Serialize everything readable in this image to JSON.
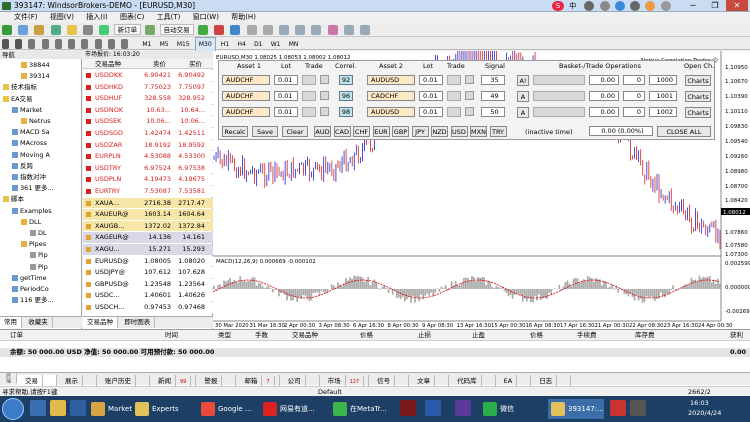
{
  "window": {
    "title": "393147: WindsorBrokers-DEMO - [EURUSD,M30]",
    "controls": [
      "─",
      "❐",
      "✕"
    ]
  },
  "ime": {
    "label": "中"
  },
  "menu": [
    "文件(F)",
    "视图(V)",
    "插入(I)",
    "图表(C)",
    "工具(T)",
    "窗口(W)",
    "帮助(H)"
  ],
  "toolbar": {
    "new_order": "新订单",
    "auto_trade": "自动交易"
  },
  "timeframes": [
    "M1",
    "M5",
    "M15",
    "M30",
    "H1",
    "H4",
    "D1",
    "W1",
    "MN"
  ],
  "navigator": {
    "title": "导航",
    "items": [
      {
        "label": "38844",
        "level": 2
      },
      {
        "label": "39314",
        "level": 2
      },
      {
        "label": "技术指标",
        "level": 0
      },
      {
        "label": "EA交易",
        "level": 0
      },
      {
        "label": "Market",
        "level": 1
      },
      {
        "label": "Netrus",
        "level": 2
      },
      {
        "label": "MACD Sa",
        "level": 1
      },
      {
        "label": "MAcross",
        "level": 1
      },
      {
        "label": "Moving A",
        "level": 1
      },
      {
        "label": "反跨",
        "level": 1
      },
      {
        "label": "指数对冲",
        "level": 1
      },
      {
        "label": "361 更多...",
        "level": 1
      },
      {
        "label": "脚本",
        "level": 0
      },
      {
        "label": "Examples",
        "level": 1
      },
      {
        "label": "DLL",
        "level": 2
      },
      {
        "label": "DL",
        "level": 3
      },
      {
        "label": "Pipes",
        "level": 2
      },
      {
        "label": "Pip",
        "level": 3
      },
      {
        "label": "Pip",
        "level": 3
      },
      {
        "label": "getTime",
        "level": 1
      },
      {
        "label": "PeriodCo",
        "level": 1
      },
      {
        "label": "116 更多...",
        "level": 1
      }
    ],
    "tabs": [
      "常用",
      "收藏夹"
    ]
  },
  "market_watch": {
    "title": "市场报价: 16:03:20",
    "headers": {
      "symbol": "交易品种",
      "bid": "卖价",
      "ask": "买价"
    },
    "rows": [
      {
        "symbol": "USDDKK",
        "bid": "6.90421",
        "ask": "6.90492",
        "style": "red"
      },
      {
        "symbol": "USDHKD",
        "bid": "7.75023",
        "ask": "7.75097",
        "style": "red"
      },
      {
        "symbol": "USDHUF",
        "bid": "328.558",
        "ask": "328.952",
        "style": "red"
      },
      {
        "symbol": "USDNOK",
        "bid": "10.63...",
        "ask": "10.64...",
        "style": "red"
      },
      {
        "symbol": "USDSEK",
        "bid": "10.06...",
        "ask": "10.06...",
        "style": "red"
      },
      {
        "symbol": "USDSGD",
        "bid": "1.42474",
        "ask": "1.42511",
        "style": "red"
      },
      {
        "symbol": "USDZAR",
        "bid": "18.9192",
        "ask": "18.9592",
        "style": "red"
      },
      {
        "symbol": "EURPLN",
        "bid": "4.53088",
        "ask": "4.53300",
        "style": "red"
      },
      {
        "symbol": "USDTRY",
        "bid": "6.97524",
        "ask": "6.97538",
        "style": "red"
      },
      {
        "symbol": "USDPLN",
        "bid": "4.19473",
        "ask": "4.19675",
        "style": "red"
      },
      {
        "symbol": "EURTRY",
        "bid": "7.53087",
        "ask": "7.53581",
        "style": "red"
      },
      {
        "symbol": "XAUA...",
        "bid": "2716.38",
        "ask": "2717.47",
        "style": "gold"
      },
      {
        "symbol": "XAUEUR@",
        "bid": "1603.14",
        "ask": "1604.64",
        "style": "gold"
      },
      {
        "symbol": "XAUGB...",
        "bid": "1372.02",
        "ask": "1372.84",
        "style": "gold"
      },
      {
        "symbol": "XAGEUR@",
        "bid": "14.136",
        "ask": "14.161",
        "style": "silver"
      },
      {
        "symbol": "XAGU...",
        "bid": "15.271",
        "ask": "15.293",
        "style": "silver"
      },
      {
        "symbol": "EURUSD@",
        "bid": "1.08005",
        "ask": "1.08020",
        "style": "plain"
      },
      {
        "symbol": "USDJPY@",
        "bid": "107.612",
        "ask": "107.628",
        "style": "plain"
      },
      {
        "symbol": "GBPUSD@",
        "bid": "1.23548",
        "ask": "1.23564",
        "style": "plain"
      },
      {
        "symbol": "USDC...",
        "bid": "1.40601",
        "ask": "1.40626",
        "style": "plain"
      },
      {
        "symbol": "USDCH...",
        "bid": "0.97453",
        "ask": "0.97468",
        "style": "plain"
      }
    ],
    "tabs": [
      "交易品种",
      "即时图表"
    ]
  },
  "chart": {
    "header": "EURUSD,M30 1.08025 1.08053 1.08002 1.08012",
    "ea_label": "Netrus Correlation Trader ☺",
    "current_price": "1.08012",
    "indicator_label": "MACD(12,26,9) 0.000669 -0.000102",
    "price_ticks": [
      "1.10950",
      "1.10670",
      "1.10390",
      "1.10110",
      "1.09830",
      "1.09540",
      "1.09260",
      "1.08980",
      "1.08700",
      "1.08420",
      "1.08012",
      "1.07860",
      "1.07580",
      "1.07300"
    ],
    "macd_ticks": [
      "0.002599",
      "0.000000",
      "-0.00269"
    ],
    "time_ticks": [
      "30 Mar 2020",
      "31 Mar 16:30",
      "2 Apr 00:30",
      "3 Apr 08:30",
      "6 Apr 16:30",
      "8 Apr 00:30",
      "9 Apr 08:30",
      "13 Apr 16:30",
      "15 Apr 00:30",
      "16 Apr 08:30",
      "17 Apr 16:30",
      "21 Apr 00:30",
      "22 Apr 08:30",
      "23 Apr 16:30",
      "24 Apr 00:30"
    ]
  },
  "overlay": {
    "headers": {
      "asset1": "Asset 1",
      "lot1": "Lot",
      "trade1": "Trade",
      "correl": "Correl.",
      "asset2": "Asset 2",
      "lot2": "Lot",
      "trade2": "Trade",
      "signal": "Signal",
      "ops": "Basket-/Trade Operations",
      "open": "Open Ch."
    },
    "rows": [
      {
        "asset1": "AUDCHF",
        "lot1": "0.01",
        "correl": "92",
        "asset2": "AUDUSD",
        "lot2": "0.01",
        "signal": "35",
        "aflag": "A!",
        "v1": "0.00",
        "v2": "0",
        "magic": "1000",
        "chart": "Charts"
      },
      {
        "asset1": "AUDCHF",
        "lot1": "0.01",
        "correl": "96",
        "asset2": "CADCHF",
        "lot2": "0.01",
        "signal": "49",
        "aflag": "A",
        "v1": "0.00",
        "v2": "0",
        "magic": "1001",
        "chart": "Charts"
      },
      {
        "asset1": "AUDCHF",
        "lot1": "0.01",
        "correl": "98",
        "asset2": "AUDUSD",
        "lot2": "0.01",
        "signal": "50",
        "aflag": "A",
        "v1": "0.00",
        "v2": "0",
        "magic": "1002",
        "chart": "Charts"
      }
    ],
    "buttons": [
      "Recalc",
      "Save",
      "Clear"
    ],
    "currencies": [
      "AUD",
      "CAD",
      "CHF",
      "EUR",
      "GBP",
      "JPY",
      "NZD",
      "USD",
      "MXN",
      "TRY"
    ],
    "inactive_label": "(inactive time)",
    "total": "0.00 (0.00%)",
    "close_all": "CLOSE ALL"
  },
  "terminal": {
    "headers": [
      "订单",
      "时间",
      "类型",
      "手数",
      "交易品种",
      "价格",
      "止损",
      "止盈",
      "价格",
      "手续费",
      "库存费",
      "获利"
    ],
    "balance": "余额: 50 000.00 USD  净值: 50 000.00  可用预付款: 50 000.00",
    "profit": "0.00",
    "tabs": [
      {
        "label": "交易",
        "badge": ""
      },
      {
        "label": "展示",
        "badge": ""
      },
      {
        "label": "账户历史",
        "badge": ""
      },
      {
        "label": "新闻",
        "badge": "99"
      },
      {
        "label": "警报",
        "badge": ""
      },
      {
        "label": "邮箱",
        "badge": "7"
      },
      {
        "label": "公司",
        "badge": ""
      },
      {
        "label": "市场",
        "badge": "127"
      },
      {
        "label": "信号",
        "badge": ""
      },
      {
        "label": "文章",
        "badge": ""
      },
      {
        "label": "代码库",
        "badge": ""
      },
      {
        "label": "EA",
        "badge": ""
      },
      {
        "label": "日志",
        "badge": ""
      }
    ],
    "side_label": "终端"
  },
  "statusbar": {
    "help": "寻求帮助,请按F1键",
    "profile": "Default",
    "conn": "2662/2"
  },
  "taskbar": {
    "apps": [
      "Market",
      "Experts",
      "Google ...",
      "网易有道...",
      "在MetaTr...",
      "微信",
      "393147:..."
    ],
    "time": "16:03",
    "date": "2020/4/24"
  },
  "colors": {
    "bull": "#0000cc",
    "bear": "#cc0000",
    "signal": "#e00000",
    "macd": "#aaaaaa"
  }
}
